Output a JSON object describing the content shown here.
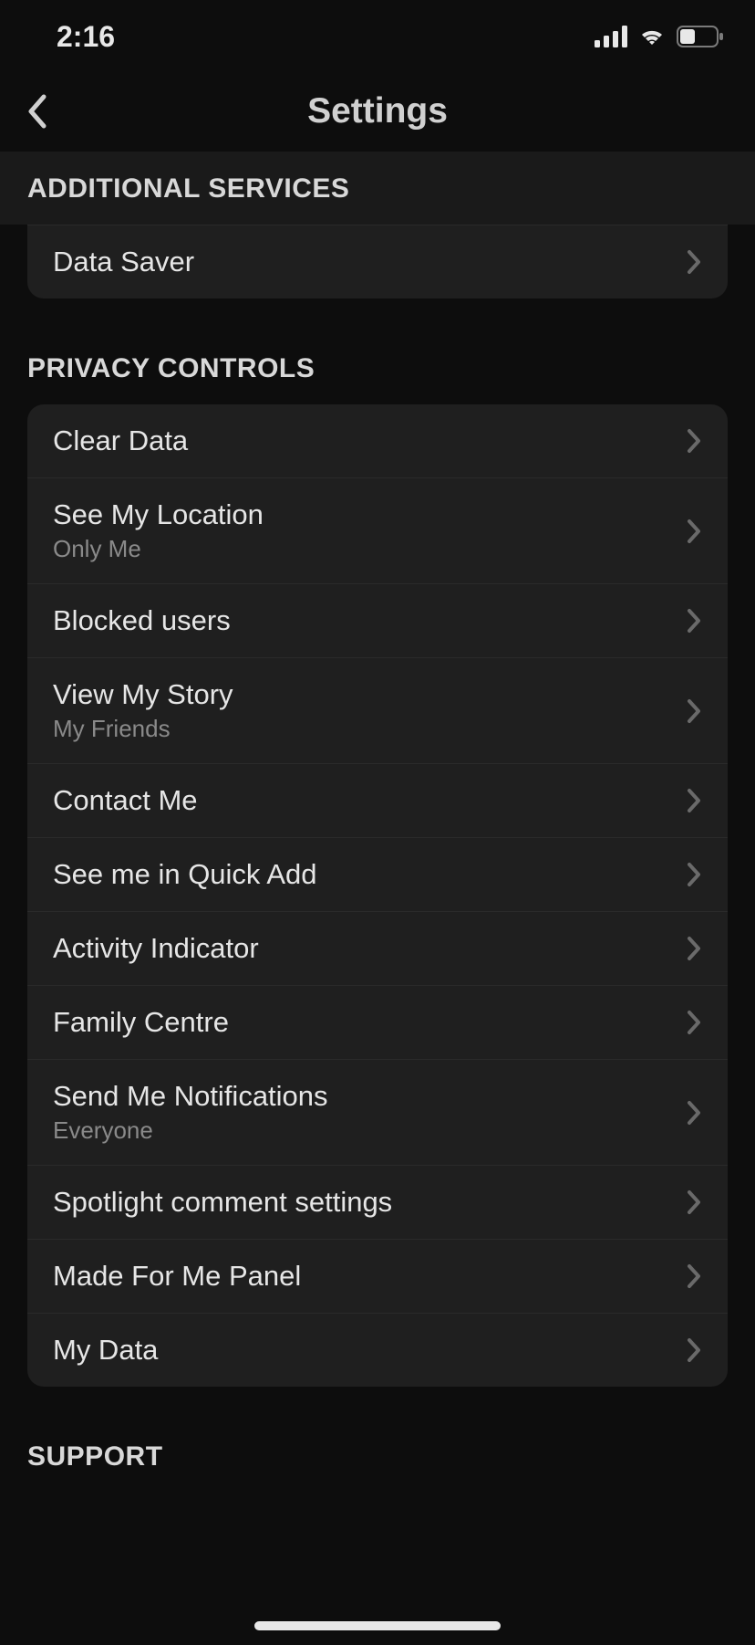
{
  "status": {
    "time": "2:16"
  },
  "nav": {
    "title": "Settings"
  },
  "sections": {
    "additional_services": {
      "header": "ADDITIONAL SERVICES",
      "items": [
        {
          "label": "Data Saver"
        }
      ]
    },
    "privacy_controls": {
      "header": "PRIVACY CONTROLS",
      "items": [
        {
          "label": "Clear Data"
        },
        {
          "label": "See My Location",
          "sublabel": "Only Me"
        },
        {
          "label": "Blocked users"
        },
        {
          "label": "View My Story",
          "sublabel": "My Friends"
        },
        {
          "label": "Contact Me"
        },
        {
          "label": "See me in Quick Add"
        },
        {
          "label": "Activity Indicator"
        },
        {
          "label": "Family Centre"
        },
        {
          "label": "Send Me Notifications",
          "sublabel": "Everyone"
        },
        {
          "label": "Spotlight comment settings"
        },
        {
          "label": "Made For Me Panel"
        },
        {
          "label": "My Data"
        }
      ]
    },
    "support": {
      "header": "SUPPORT"
    }
  }
}
